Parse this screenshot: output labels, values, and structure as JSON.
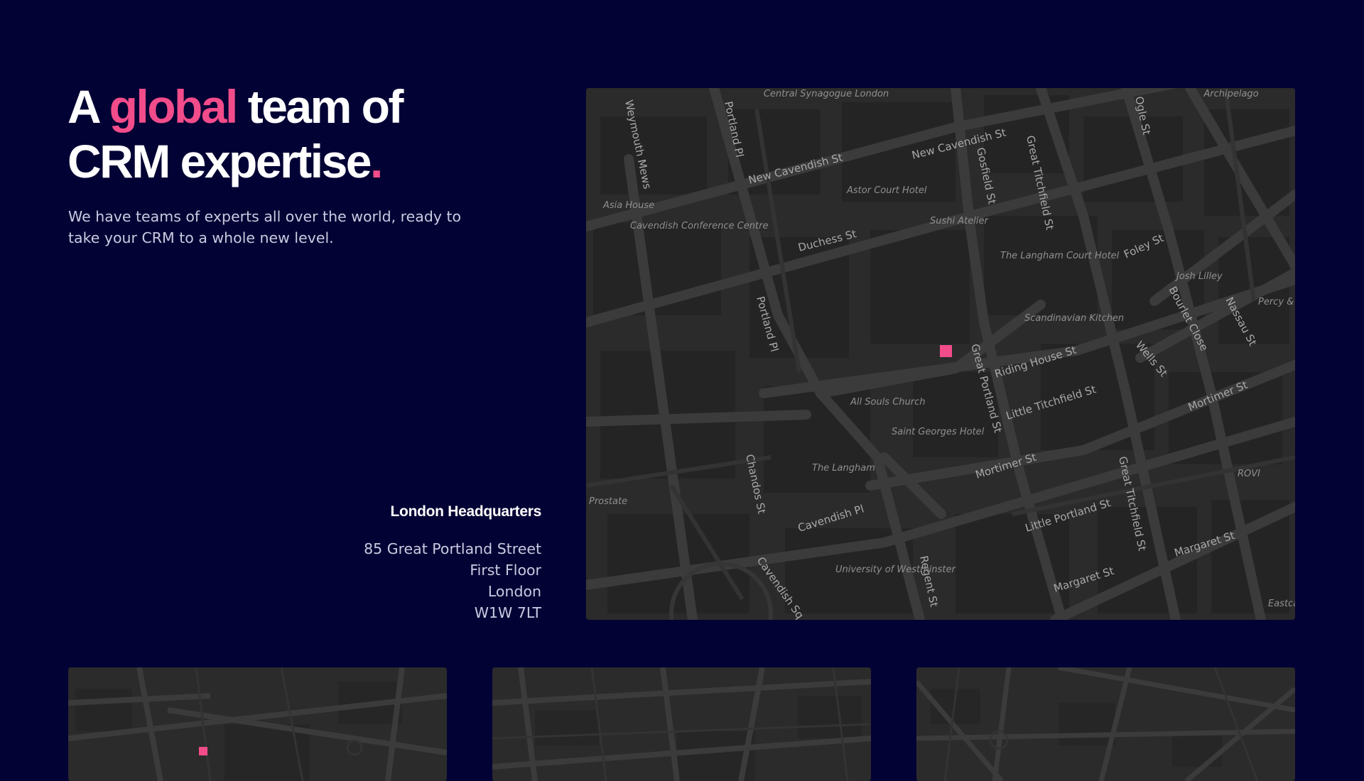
{
  "hero": {
    "title_part1": "A ",
    "title_accent": "global",
    "title_part2": " team of",
    "title_line2": "CRM expertise",
    "title_dot": ".",
    "subtitle": "We have teams of experts all over the world, ready to take your CRM to a whole new level."
  },
  "headquarters": {
    "title": "London Headquarters",
    "address_lines": [
      "85 Great Portland Street",
      "First Floor",
      "London",
      "W1W 7LT"
    ]
  },
  "map_main": {
    "streets": [
      "New Cavendish St",
      "New Cavendish St",
      "Duchess St",
      "Portland Pl",
      "Portland Pl",
      "Great Portland St",
      "Riding House St",
      "Little Titchfield St",
      "Mortimer St",
      "Mortimer St",
      "Cavendish Pl",
      "Little Portland St",
      "Margaret St",
      "Margaret St",
      "Foley St",
      "Great Titchfield St",
      "Great Titchfield St",
      "Gosfield St",
      "Weymouth Mews",
      "Chandos St",
      "Cavendish Sq",
      "Regent St",
      "Ogle St",
      "Bourlet Close",
      "Nassau St",
      "Wells St"
    ],
    "pois": [
      "Central Synagogue London",
      "Archipelago",
      "Asia House",
      "Cavendish Conference Centre",
      "Astor Court Hotel",
      "Sushi Atelier",
      "The Langham Court Hotel",
      "Josh Lilley",
      "Percy &",
      "Scandinavian Kitchen",
      "All Souls Church",
      "Saint Georges Hotel",
      "The Langham",
      "ROVI",
      "Prostate",
      "University of Westminster",
      "Eastca"
    ]
  },
  "colors": {
    "background": "#030234",
    "accent": "#f24c8a",
    "map_base": "#2b2b2b",
    "text_muted": "#c9cbe2"
  }
}
